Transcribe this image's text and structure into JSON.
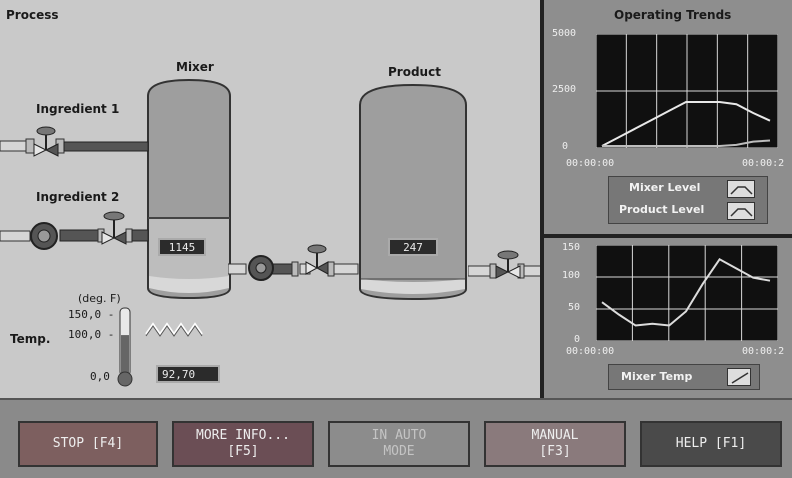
{
  "process": {
    "title": "Process",
    "mixer_label": "Mixer",
    "product_label": "Product",
    "ingredient1_label": "Ingredient 1",
    "ingredient2_label": "Ingredient 2",
    "mixer_value": "1145",
    "product_value": "247",
    "temp_label": "Temp.",
    "temp_unit": "(deg. F)",
    "temp_scale": [
      "150,0 -",
      "100,0 -",
      "0,0 -"
    ],
    "temp_value": "92,70",
    "temp_level_fraction": 0.62
  },
  "trends": {
    "title": "Operating Trends",
    "chart1": {
      "y_ticks": [
        "5000",
        "2500",
        "0"
      ],
      "x_ticks": [
        "00:00:00",
        "00:00:2"
      ],
      "legend": [
        "Mixer Level",
        "Product Level"
      ]
    },
    "chart2": {
      "y_ticks": [
        "150",
        "100",
        "50",
        "0"
      ],
      "x_ticks": [
        "00:00:00",
        "00:00:2"
      ],
      "legend": [
        "Mixer Temp"
      ]
    }
  },
  "buttons": {
    "stop": "STOP [F4]",
    "more_info": "MORE INFO...\n[F5]",
    "auto": "IN AUTO\nMODE",
    "manual": "MANUAL\n[F3]",
    "help": "HELP [F1]"
  },
  "chart_data": [
    {
      "type": "line",
      "title": "Operating Trends",
      "xlabel": "",
      "ylabel": "",
      "ylim": [
        0,
        5000
      ],
      "x": [
        0,
        1,
        2,
        3,
        4,
        5,
        6,
        7,
        8,
        9,
        10
      ],
      "series": [
        {
          "name": "Mixer Level",
          "values": [
            0,
            400,
            800,
            1200,
            1600,
            2000,
            2000,
            2000,
            1900,
            1500,
            1150
          ]
        },
        {
          "name": "Product Level",
          "values": [
            0,
            0,
            0,
            0,
            0,
            0,
            0,
            0,
            50,
            200,
            250
          ]
        }
      ],
      "grid": true,
      "legend": "bottom"
    },
    {
      "type": "line",
      "xlabel": "",
      "ylabel": "",
      "ylim": [
        0,
        150
      ],
      "x": [
        0,
        1,
        2,
        3,
        4,
        5,
        6,
        7,
        8,
        9,
        10
      ],
      "series": [
        {
          "name": "Mixer Temp",
          "values": [
            60,
            40,
            22,
            25,
            22,
            45,
            90,
            130,
            115,
            100,
            95
          ]
        }
      ],
      "grid": true,
      "legend": "bottom"
    }
  ]
}
